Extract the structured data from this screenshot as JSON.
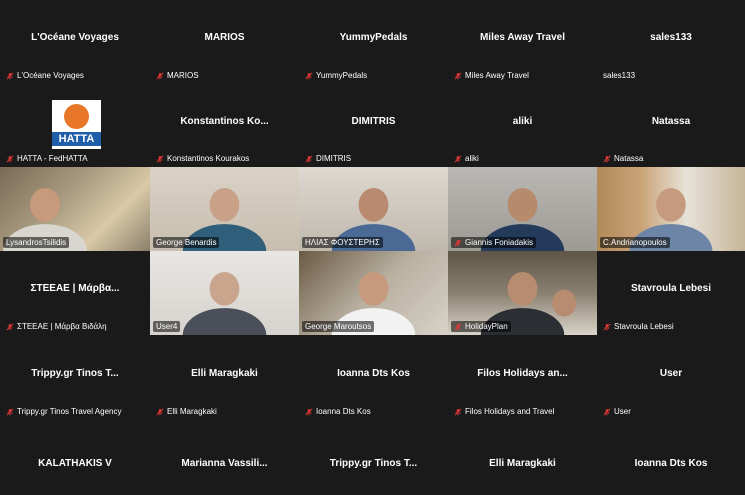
{
  "rows": [
    [
      {
        "center": "L'Océane Voyages",
        "label": "L'Océane Voyages",
        "muted": true
      },
      {
        "center": "MARIOS",
        "label": "MARIOS",
        "muted": true
      },
      {
        "center": "YummyPedals",
        "label": "YummyPedals",
        "muted": true
      },
      {
        "center": "Miles Away Travel",
        "label": "Miles Away Travel",
        "muted": true
      },
      {
        "center": "sales133",
        "label": "sales133",
        "muted": false
      }
    ],
    [
      {
        "center": "",
        "label": "HATTA - FedHATTA",
        "muted": true,
        "logo_text": "HATTA"
      },
      {
        "center": "Konstantinos  Ko...",
        "label": "Konstantinos Kourakos",
        "muted": true
      },
      {
        "center": "DIMITRIS",
        "label": "DIMITRIS",
        "muted": true
      },
      {
        "center": "aliki",
        "label": "aliki",
        "muted": true
      },
      {
        "center": "Natassa",
        "label": "Natassa",
        "muted": true
      }
    ],
    [
      {
        "center": "",
        "label": "LysandrosTsilidis",
        "muted": false,
        "video": true
      },
      {
        "center": "",
        "label": "George Benardis",
        "muted": false,
        "video": true
      },
      {
        "center": "",
        "label": "ΗΛΙΑΣ ΦΟΥΣΤΕΡΗΣ",
        "muted": false,
        "video": true
      },
      {
        "center": "",
        "label": "Giannis Foniadakis",
        "muted": true,
        "video": true
      },
      {
        "center": "",
        "label": "C.Andrianopoulos",
        "muted": false,
        "video": true
      }
    ],
    [
      {
        "center": "ΣΤΕΕΑΕ | Μάρβα...",
        "label": "ΣΤΕΕΑΕ | Μάρβα Βιδάλη",
        "muted": true
      },
      {
        "center": "",
        "label": "User4",
        "muted": false,
        "video": true
      },
      {
        "center": "",
        "label": "George Maroutsos",
        "muted": false,
        "video": true
      },
      {
        "center": "",
        "label": "HolidayPlan",
        "muted": true,
        "video": true
      },
      {
        "center": "Stavroula Lebesi",
        "label": "Stavroula Lebesi",
        "muted": true
      }
    ],
    [
      {
        "center": "Trippy.gr Tinos T...",
        "label": "Trippy.gr Tinos Travel Agency",
        "muted": true
      },
      {
        "center": "Elli Maragkaki",
        "label": "Elli Maragkaki",
        "muted": true
      },
      {
        "center": "Ioanna Dts Kos",
        "label": "Ioanna Dts Kos",
        "muted": true
      },
      {
        "center": "Filos Holidays  an...",
        "label": "Filos Holidays and Travel",
        "muted": true
      },
      {
        "center": "User",
        "label": "User",
        "muted": true
      }
    ],
    [
      {
        "center": "KALATHAKIS V",
        "label": "",
        "muted": false
      },
      {
        "center": "Marianna  Vassili...",
        "label": "",
        "muted": false
      },
      {
        "center": "Trippy.gr Tinos T...",
        "label": "",
        "muted": false
      },
      {
        "center": "Elli Maragkaki",
        "label": "",
        "muted": false
      },
      {
        "center": "Ioanna Dts Kos",
        "label": "",
        "muted": false
      }
    ]
  ],
  "colors": {
    "active_speaker": "#2ec94a",
    "mute_red": "#e53935",
    "background": "#1a1a1a"
  }
}
